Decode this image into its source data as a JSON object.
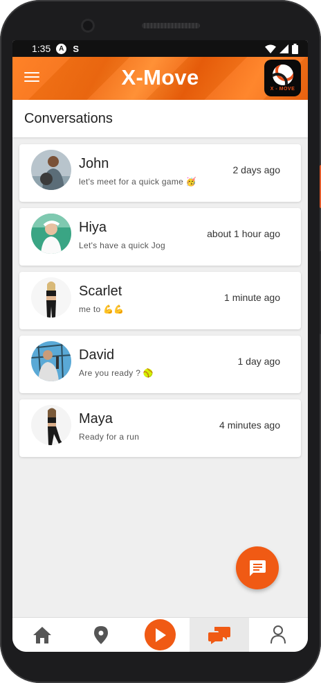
{
  "status_bar": {
    "time": "1:35",
    "glyph_a": "A",
    "glyph_b": "S"
  },
  "app_bar": {
    "title": "X-Move",
    "logo_text": "X - MOVE"
  },
  "header": {
    "title": "Conversations"
  },
  "conversations": [
    {
      "name": "John",
      "preview": "let's meet for a quick game 🥳",
      "time": "2 days ago"
    },
    {
      "name": "Hiya",
      "preview": "Let's have a quick Jog",
      "time": "about 1 hour ago"
    },
    {
      "name": "Scarlet",
      "preview": "me to 💪💪",
      "time": "1 minute ago"
    },
    {
      "name": "David",
      "preview": "Are you ready ? 🥎",
      "time": "1 day ago"
    },
    {
      "name": "Maya",
      "preview": "Ready for a run",
      "time": "4 minutes ago"
    }
  ],
  "fab": {
    "icon": "message-icon"
  },
  "bottom_nav": [
    {
      "icon": "home-icon",
      "active": false
    },
    {
      "icon": "location-pin-icon",
      "active": false
    },
    {
      "icon": "play-icon",
      "active": false
    },
    {
      "icon": "chat-icon",
      "active": true
    },
    {
      "icon": "person-icon",
      "active": false
    }
  ],
  "colors": {
    "accent": "#f05a14",
    "background": "#efefef"
  }
}
